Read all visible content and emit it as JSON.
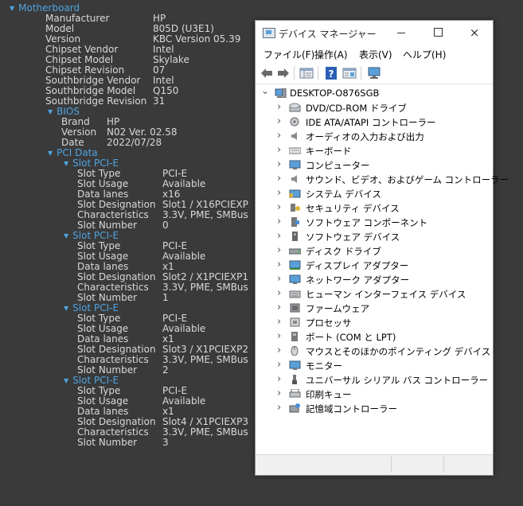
{
  "info": {
    "motherboard_header": "Motherboard",
    "motherboard": [
      {
        "label": "Manufacturer",
        "value": "HP"
      },
      {
        "label": "Model",
        "value": "805D (U3E1)"
      },
      {
        "label": "Version",
        "value": "KBC Version 05.39"
      },
      {
        "label": "Chipset Vendor",
        "value": "Intel"
      },
      {
        "label": "Chipset Model",
        "value": "Skylake"
      },
      {
        "label": "Chipset Revision",
        "value": "07"
      },
      {
        "label": "Southbridge Vendor",
        "value": "Intel"
      },
      {
        "label": "Southbridge Model",
        "value": "Q150"
      },
      {
        "label": "Southbridge Revision",
        "value": "31"
      }
    ],
    "bios_header": "BIOS",
    "bios": [
      {
        "label": "Brand",
        "value": "HP"
      },
      {
        "label": "Version",
        "value": "N02 Ver. 02.58"
      },
      {
        "label": "Date",
        "value": "2022/07/28"
      }
    ],
    "pci_header": "PCI Data",
    "slots": [
      {
        "header": "Slot PCI-E",
        "fields": [
          {
            "label": "Slot Type",
            "value": "PCI-E"
          },
          {
            "label": "Slot Usage",
            "value": "Available"
          },
          {
            "label": "Data lanes",
            "value": "x16"
          },
          {
            "label": "Slot Designation",
            "value": "Slot1 / X16PCIEXP"
          },
          {
            "label": "Characteristics",
            "value": "3.3V, PME, SMBus"
          },
          {
            "label": "Slot Number",
            "value": "0"
          }
        ]
      },
      {
        "header": "Slot PCI-E",
        "fields": [
          {
            "label": "Slot Type",
            "value": "PCI-E"
          },
          {
            "label": "Slot Usage",
            "value": "Available"
          },
          {
            "label": "Data lanes",
            "value": "x1"
          },
          {
            "label": "Slot Designation",
            "value": "Slot2 / X1PCIEXP1"
          },
          {
            "label": "Characteristics",
            "value": "3.3V, PME, SMBus"
          },
          {
            "label": "Slot Number",
            "value": "1"
          }
        ]
      },
      {
        "header": "Slot PCI-E",
        "fields": [
          {
            "label": "Slot Type",
            "value": "PCI-E"
          },
          {
            "label": "Slot Usage",
            "value": "Available"
          },
          {
            "label": "Data lanes",
            "value": "x1"
          },
          {
            "label": "Slot Designation",
            "value": "Slot3 / X1PCIEXP2"
          },
          {
            "label": "Characteristics",
            "value": "3.3V, PME, SMBus"
          },
          {
            "label": "Slot Number",
            "value": "2"
          }
        ]
      },
      {
        "header": "Slot PCI-E",
        "fields": [
          {
            "label": "Slot Type",
            "value": "PCI-E"
          },
          {
            "label": "Slot Usage",
            "value": "Available"
          },
          {
            "label": "Data lanes",
            "value": "x1"
          },
          {
            "label": "Slot Designation",
            "value": "Slot4 / X1PCIEXP3"
          },
          {
            "label": "Characteristics",
            "value": "3.3V, PME, SMBus"
          },
          {
            "label": "Slot Number",
            "value": "3"
          }
        ]
      }
    ]
  },
  "device_manager": {
    "title": "デバイス マネージャー",
    "window_buttons": {
      "close": "×"
    },
    "menus": [
      "ファイル(F)",
      "操作(A)",
      "表示(V)",
      "ヘルプ(H)"
    ],
    "toolbar_icons": [
      "back-arrow-icon",
      "forward-arrow-icon",
      "show-hide-icon",
      "help-icon",
      "properties-icon",
      "monitor-scan-icon"
    ],
    "root": "DESKTOP-O876SGB",
    "categories": [
      {
        "label": "DVD/CD-ROM ドライブ",
        "icon": "dvd-drive-icon"
      },
      {
        "label": "IDE ATA/ATAPI コントローラー",
        "icon": "ide-controller-icon"
      },
      {
        "label": "オーディオの入力および出力",
        "icon": "speaker-icon"
      },
      {
        "label": "キーボード",
        "icon": "keyboard-icon"
      },
      {
        "label": "コンピューター",
        "icon": "computer-icon"
      },
      {
        "label": "サウンド、ビデオ、およびゲーム コントローラー",
        "icon": "sound-icon"
      },
      {
        "label": "システム デバイス",
        "icon": "system-devices-icon"
      },
      {
        "label": "セキュリティ デバイス",
        "icon": "security-icon"
      },
      {
        "label": "ソフトウェア コンポーネント",
        "icon": "software-component-icon"
      },
      {
        "label": "ソフトウェア デバイス",
        "icon": "software-device-icon"
      },
      {
        "label": "ディスク ドライブ",
        "icon": "disk-drive-icon"
      },
      {
        "label": "ディスプレイ アダプター",
        "icon": "display-adapter-icon"
      },
      {
        "label": "ネットワーク アダプター",
        "icon": "network-adapter-icon"
      },
      {
        "label": "ヒューマン インターフェイス デバイス",
        "icon": "hid-icon"
      },
      {
        "label": "ファームウェア",
        "icon": "firmware-icon"
      },
      {
        "label": "プロセッサ",
        "icon": "processor-icon"
      },
      {
        "label": "ポート (COM と LPT)",
        "icon": "port-icon"
      },
      {
        "label": "マウスとそのほかのポインティング デバイス",
        "icon": "mouse-icon"
      },
      {
        "label": "モニター",
        "icon": "monitor-icon"
      },
      {
        "label": "ユニバーサル シリアル バス コントローラー",
        "icon": "usb-icon"
      },
      {
        "label": "印刷キュー",
        "icon": "printer-icon"
      },
      {
        "label": "記憶域コントローラー",
        "icon": "storage-controller-icon"
      }
    ]
  }
}
